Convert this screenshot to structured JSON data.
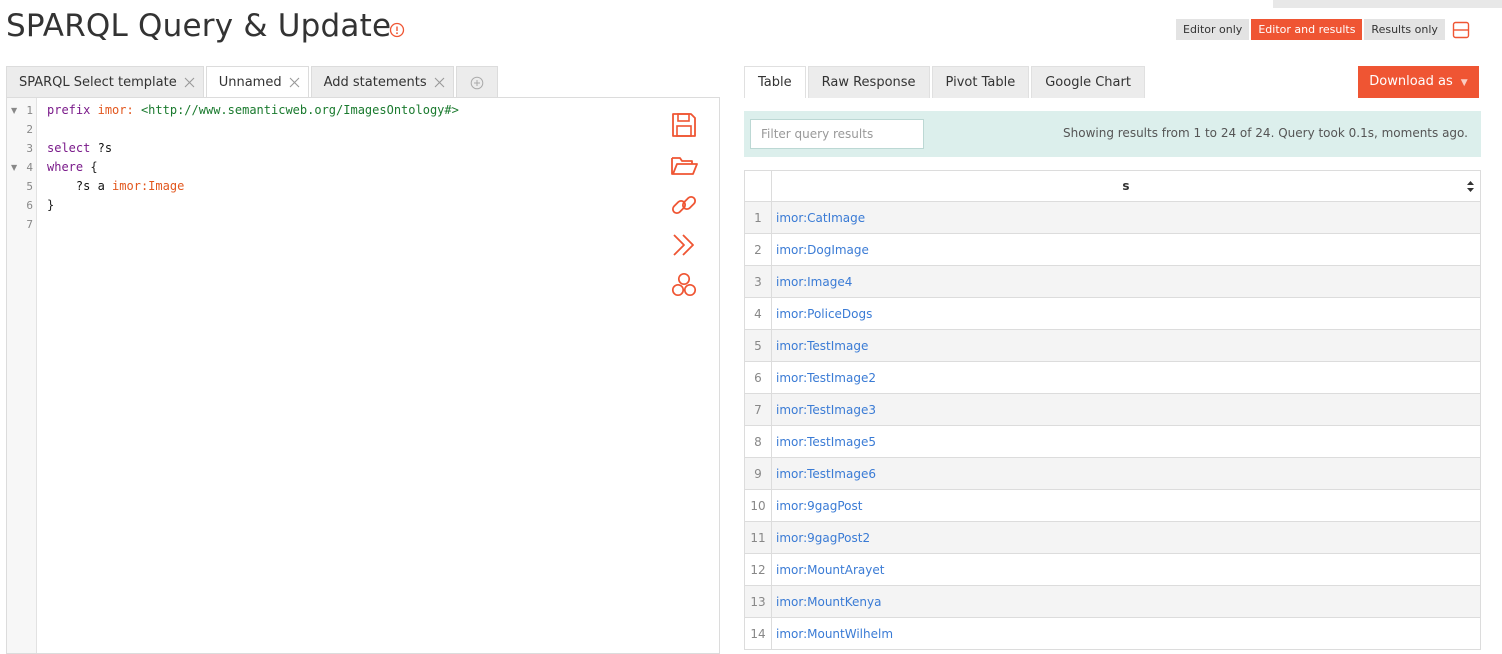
{
  "page": {
    "title": "SPARQL Query & Update",
    "info_icon": "info-icon"
  },
  "view_modes": {
    "items": [
      "Editor only",
      "Editor and results",
      "Results only"
    ],
    "active": "Editor and results",
    "layout_icon": "horizontal-layout-icon"
  },
  "editor": {
    "tabs": [
      "SPARQL Select template",
      "Unnamed",
      "Add statements"
    ],
    "active_tab": "Unnamed",
    "add_tab_icon": "plus-circle-icon",
    "line_numbers": [
      "1",
      "2",
      "3",
      "4",
      "5",
      "6",
      "7"
    ],
    "code": {
      "l1_kw": "prefix",
      "l1_pfx": "imor:",
      "l1_iri": "<http://www.semanticweb.org/ImagesOntology#>",
      "l3_kw": "select",
      "l3_var": "?s",
      "l4_kw": "where",
      "l4_brace": "{",
      "l5_subject": "?s a",
      "l5_object": "imor:Image",
      "l6_brace": "}"
    },
    "tools": [
      "save-icon",
      "open-folder-icon",
      "link-icon",
      "run-icon",
      "share-icon"
    ]
  },
  "results": {
    "tabs": [
      "Table",
      "Raw Response",
      "Pivot Table",
      "Google Chart"
    ],
    "active_tab": "Table",
    "download_label": "Download as",
    "filter_placeholder": "Filter query results",
    "status": "Showing results from 1 to 24 of 24. Query took 0.1s, moments ago.",
    "column": "s",
    "rows": [
      {
        "idx": "1",
        "value": "imor:CatImage"
      },
      {
        "idx": "2",
        "value": "imor:DogImage"
      },
      {
        "idx": "3",
        "value": "imor:Image4"
      },
      {
        "idx": "4",
        "value": "imor:PoliceDogs"
      },
      {
        "idx": "5",
        "value": "imor:TestImage"
      },
      {
        "idx": "6",
        "value": "imor:TestImage2"
      },
      {
        "idx": "7",
        "value": "imor:TestImage3"
      },
      {
        "idx": "8",
        "value": "imor:TestImage5"
      },
      {
        "idx": "9",
        "value": "imor:TestImage6"
      },
      {
        "idx": "10",
        "value": "imor:9gagPost"
      },
      {
        "idx": "11",
        "value": "imor:9gagPost2"
      },
      {
        "idx": "12",
        "value": "imor:MountArayet"
      },
      {
        "idx": "13",
        "value": "imor:MountKenya"
      },
      {
        "idx": "14",
        "value": "imor:MountWilhelm"
      }
    ]
  },
  "colors": {
    "accent": "#ef5533",
    "link": "#3a7bd5",
    "filter_bar": "#dcefec"
  }
}
